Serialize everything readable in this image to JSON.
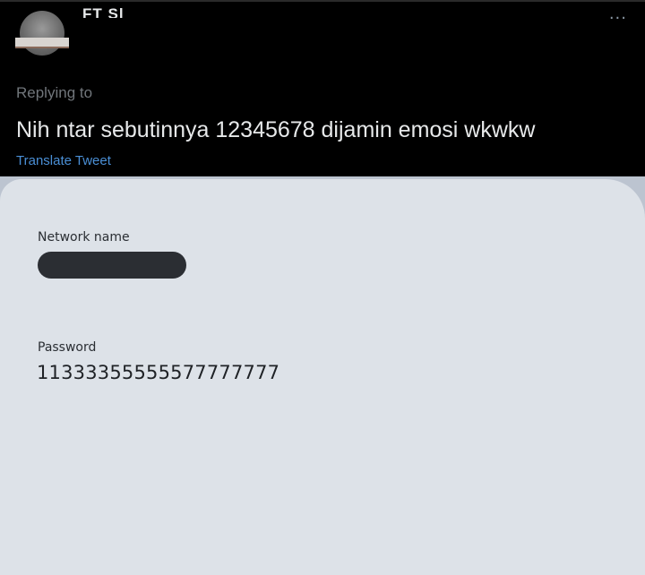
{
  "tweet": {
    "display_name": "FT Sl",
    "more_icon": "more-horizontal-icon",
    "replying_label": "Replying to",
    "text": "Nih ntar sebutinnya 12345678 dijamin emosi wkwkw",
    "translate_label": "Translate Tweet",
    "colors": {
      "background": "#000000",
      "text": "#e7e9ea",
      "muted": "#71767b",
      "link": "#4a8fd6"
    }
  },
  "wifi_card": {
    "network_label": "Network name",
    "network_value_redacted": true,
    "password_label": "Password",
    "password_value": "11333355555577777777",
    "colors": {
      "background": "#dde2e8",
      "redaction": "#2b2e33"
    }
  }
}
